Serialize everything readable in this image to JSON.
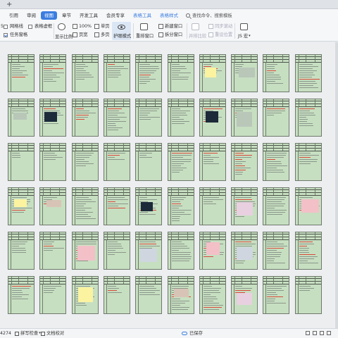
{
  "tabstrip": {
    "new_tab_label": "+"
  },
  "menu": {
    "items": [
      {
        "label": "引用",
        "state": "normal"
      },
      {
        "label": "审阅",
        "state": "normal"
      },
      {
        "label": "视图",
        "state": "active"
      },
      {
        "label": "章节",
        "state": "normal"
      },
      {
        "label": "开发工具",
        "state": "normal"
      },
      {
        "label": "会员专享",
        "state": "normal"
      },
      {
        "label": "表格工具",
        "state": "special"
      },
      {
        "label": "表格样式",
        "state": "special"
      }
    ],
    "search_placeholder": "查找命令、搜索模板"
  },
  "ribbon": {
    "gridlines_label": "网格线",
    "gridlines_checked": false,
    "table_gridlines_label": "表格虚框",
    "table_gridlines_checked": false,
    "task_pane_label": "任务窗格",
    "task_pane_checked": true,
    "zoom_value": "100%",
    "single_page_label": "单页",
    "page_width_label": "页宽",
    "multi_page_label": "多页",
    "show_ratio_label": "显示比例",
    "eye_mode_label": "护眼模式",
    "rearrange_window_label": "重排窗口",
    "new_window_label": "新建窗口",
    "split_window_label": "拆分窗口",
    "sync_scroll_label": "同步滚动",
    "side_by_side_label": "并排比较",
    "reset_position_label": "重设位置",
    "js_macro_label": "JS 宏",
    "partial_left_label": "5"
  },
  "statusbar": {
    "word_count": "4274",
    "spell_check_label": "拼写检查",
    "doc_proof_label": "文档校对",
    "save_status_label": "已保存"
  },
  "document": {
    "page_color": "#c7dfc1",
    "rows": 6,
    "cols": 10
  },
  "colors": {
    "accent": "#3a7de0",
    "eye_mode_page": "#c7dfc1"
  }
}
